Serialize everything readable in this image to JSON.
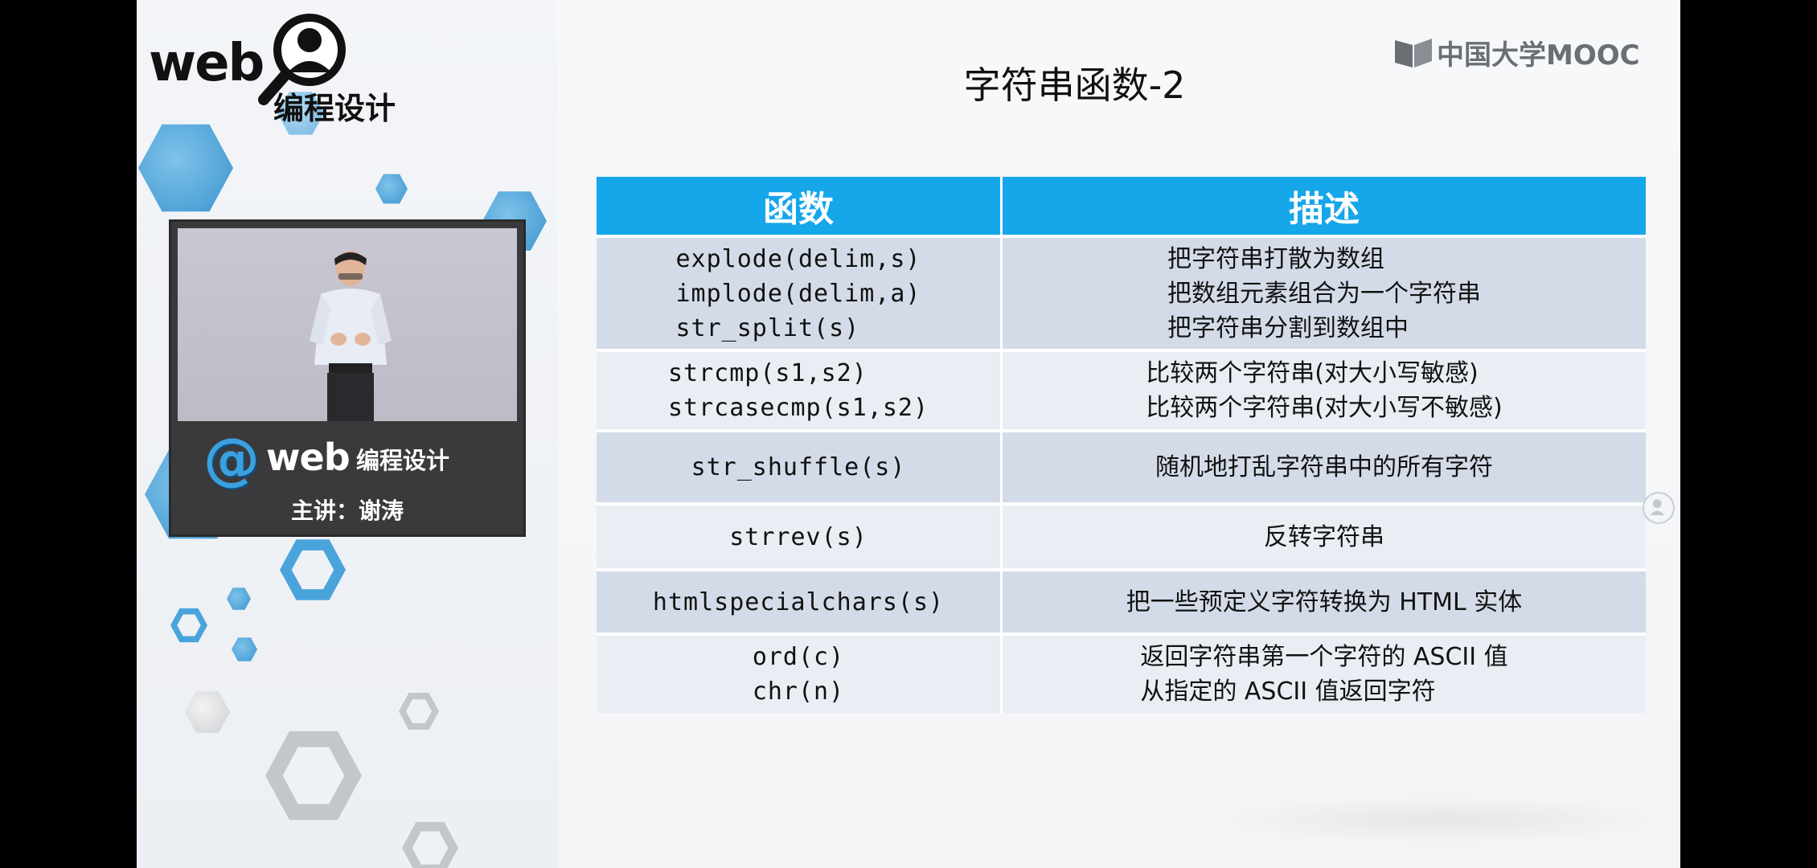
{
  "branding": {
    "logo_web": "web",
    "logo_cn": "编程设计",
    "mooc": "中国大学MOOC"
  },
  "video": {
    "overlay_web": "web",
    "overlay_cn": "编程设计",
    "presenter_caption": "主讲：谢涛"
  },
  "slide": {
    "title": "字符串函数-2",
    "table": {
      "headers": [
        "函数",
        "描述"
      ],
      "rows": [
        {
          "funcs": [
            "explode(delim,s)",
            "implode(delim,a)",
            "str_split(s)"
          ],
          "descs": [
            "把字符串打散为数组",
            "把数组元素组合为一个字符串",
            "把字符串分割到数组中"
          ]
        },
        {
          "funcs": [
            "strcmp(s1,s2)",
            "strcasecmp(s1,s2)"
          ],
          "descs": [
            "比较两个字符串(对大小写敏感)",
            "比较两个字符串(对大小写不敏感)"
          ]
        },
        {
          "funcs": [
            "str_shuffle(s)"
          ],
          "descs": [
            "随机地打乱字符串中的所有字符"
          ]
        },
        {
          "funcs": [
            "strrev(s)"
          ],
          "descs": [
            "反转字符串"
          ]
        },
        {
          "funcs": [
            "htmlspecialchars(s)"
          ],
          "descs": [
            "把一些预定义字符转换为 HTML 实体"
          ]
        },
        {
          "funcs": [
            "ord(c)",
            "chr(n)"
          ],
          "descs": [
            "返回字符串第一个字符的 ASCII 值",
            "从指定的 ASCII 值返回字符"
          ]
        }
      ]
    }
  },
  "colors": {
    "header_blue": "#16a6ea",
    "row_dark": "#d4dbe8",
    "row_light": "#e9edf4",
    "accent_blue": "#3aa0de"
  }
}
